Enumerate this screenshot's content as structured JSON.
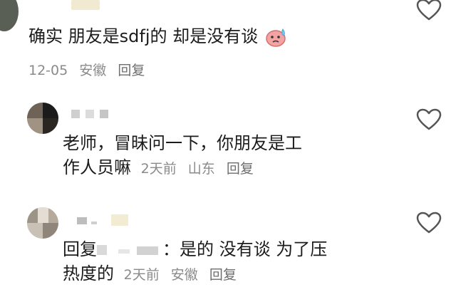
{
  "comments": [
    {
      "text": "确实 朋友是sdfj的 却是没有谈",
      "emoji": "sweat-face-emoji",
      "date": "12-05",
      "location": "安徽",
      "reply_label": "回复"
    },
    {
      "text_line1": "老师，冒昧问一下，你朋友是工",
      "text_line2": "作人员嘛",
      "date": "2天前",
      "location": "山东",
      "reply_label": "回复"
    },
    {
      "reply_prefix": "回复",
      "text_after_name": "：是的 没有谈 为了压",
      "text_line2": "热度的",
      "date": "2天前",
      "location": "安徽",
      "reply_label": "回复"
    }
  ],
  "colors": {
    "text": "#1b1b1b",
    "meta": "#8a8a8a",
    "icon": "#555555"
  }
}
